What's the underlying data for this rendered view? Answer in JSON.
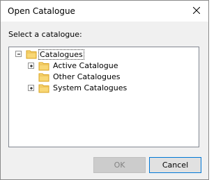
{
  "window": {
    "title": "Open Catalogue"
  },
  "prompt_label": "Select a catalogue:",
  "tree": {
    "root": {
      "label": "Catalogues",
      "expanded": true,
      "selected": true
    },
    "children": [
      {
        "label": "Active Catalogue",
        "expandable": true
      },
      {
        "label": "Other Catalogues",
        "expandable": false
      },
      {
        "label": "System Catalogues",
        "expandable": true
      }
    ]
  },
  "buttons": {
    "ok_label": "OK",
    "ok_disabled": true,
    "cancel_label": "Cancel"
  },
  "colors": {
    "accent": "#0078d7",
    "folder": "#f8d775",
    "folder_edge": "#d9a21b"
  }
}
